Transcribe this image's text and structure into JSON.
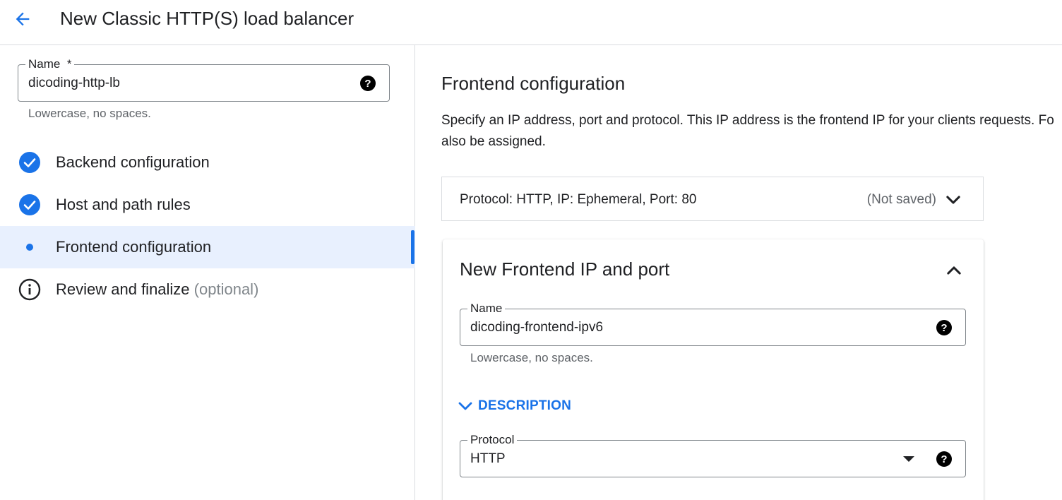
{
  "header": {
    "title": "New Classic HTTP(S) load balancer",
    "back_icon": "arrow-back-icon"
  },
  "colors": {
    "accent": "#1a73e8",
    "active_step_bg": "#e8f0fe",
    "border": "#dadce0",
    "muted_text": "#5f6368"
  },
  "left": {
    "name_field": {
      "label": "Name",
      "required_mark": "*",
      "value": "dicoding-http-lb",
      "hint": "Lowercase, no spaces."
    },
    "steps": [
      {
        "label": "Backend configuration",
        "state": "done",
        "icon": "check-circle-icon"
      },
      {
        "label": "Host and path rules",
        "state": "done",
        "icon": "check-circle-icon"
      },
      {
        "label": "Frontend configuration",
        "state": "current",
        "icon": "dot-icon"
      },
      {
        "label": "Review and finalize",
        "optional": "(optional)",
        "state": "pending",
        "icon": "info-icon"
      }
    ]
  },
  "right": {
    "title": "Frontend configuration",
    "description_line1": "Specify an IP address, port and protocol. This IP address is the frontend IP for your clients requests. Fo",
    "description_line2": "also be assigned.",
    "summary": {
      "text": "Protocol: HTTP, IP: Ephemeral, Port: 80",
      "status": "(Not saved)"
    },
    "card": {
      "title": "New Frontend IP and port",
      "name_field": {
        "label": "Name",
        "value": "dicoding-frontend-ipv6",
        "hint": "Lowercase, no spaces."
      },
      "description_toggle": "DESCRIPTION",
      "protocol_field": {
        "label": "Protocol",
        "value": "HTTP"
      }
    }
  }
}
